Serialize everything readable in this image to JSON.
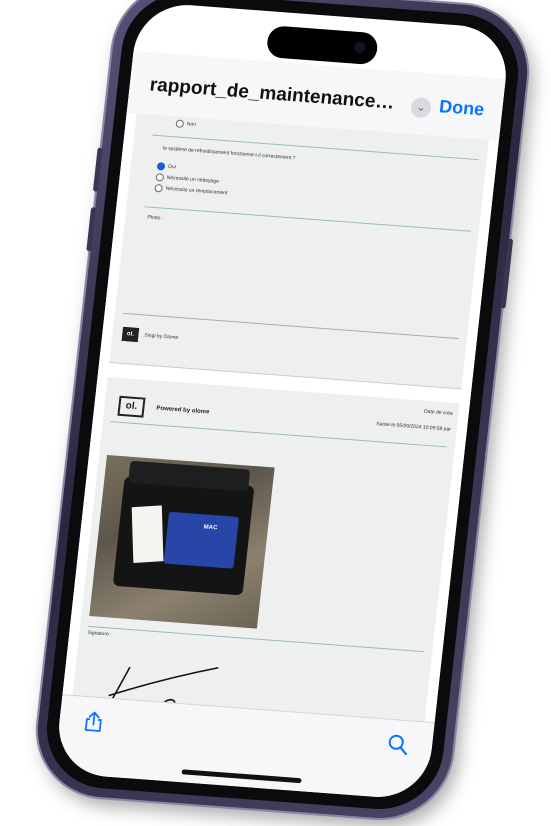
{
  "navbar": {
    "title": "rapport_de_maintenance_post...",
    "done_label": "Done",
    "chevron_icon": "chevron-down-icon"
  },
  "page1": {
    "option_top": "Non",
    "question": "le système de refroidissement fonctionne-t-il correctement ?",
    "options": [
      {
        "label": "Oui",
        "selected": true
      },
      {
        "label": "Nécessite un nettoyage",
        "selected": false
      },
      {
        "label": "Nécessite un remplacement",
        "selected": false
      }
    ],
    "photo_label": "Photo :",
    "footer_logo": "ol.",
    "footer_text": "Singl by Olome"
  },
  "page2": {
    "logo": "ol.",
    "powered_by": "Powered by olome",
    "date_label": "Date de créa",
    "saisie": "Saisie le 05/09/2024 10:09:58 par",
    "device_brand": "MAC",
    "signature_label": "Signature :"
  },
  "toolbar": {
    "share_icon": "share-icon",
    "search_icon": "search-icon"
  },
  "colors": {
    "accent": "#0a74ff",
    "frame": "#3a3552",
    "radio_selected": "#1a5fd6"
  }
}
